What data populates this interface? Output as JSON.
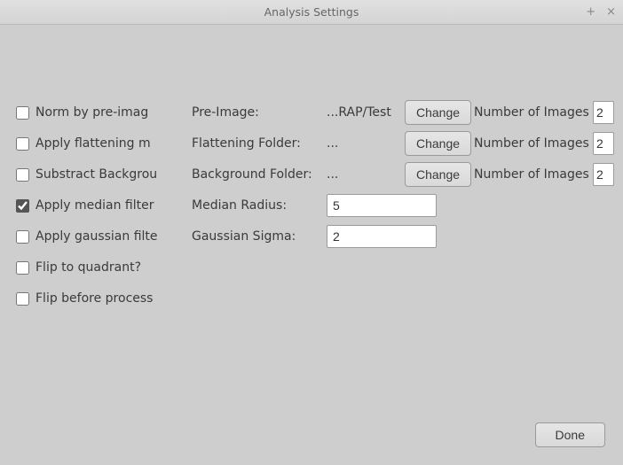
{
  "window": {
    "title": "Analysis Settings"
  },
  "rows": {
    "norm": {
      "check_label": "Norm by pre-imag",
      "checked": false,
      "param_label": "Pre-Image:",
      "value": "...RAP/Test",
      "change": "Change",
      "num_label": "Number of Images us",
      "num_value": "2"
    },
    "flatten": {
      "check_label": "Apply flattening m",
      "checked": false,
      "param_label": "Flattening Folder:",
      "value": "...",
      "change": "Change",
      "num_label": "Number of Images us",
      "num_value": "2"
    },
    "bg": {
      "check_label": "Substract Backgrou",
      "checked": false,
      "param_label": "Background Folder:",
      "value": "...",
      "change": "Change",
      "num_label": "Number of Images us",
      "num_value": "2"
    },
    "median": {
      "check_label": "Apply median filter",
      "checked": true,
      "param_label": "Median Radius:",
      "value": "5"
    },
    "gauss": {
      "check_label": "Apply gaussian filte",
      "checked": false,
      "param_label": "Gaussian Sigma:",
      "value": "2"
    },
    "flipq": {
      "check_label": "Flip to quadrant?",
      "checked": false
    },
    "flipb": {
      "check_label": "Flip before process",
      "checked": false
    }
  },
  "done": "Done"
}
